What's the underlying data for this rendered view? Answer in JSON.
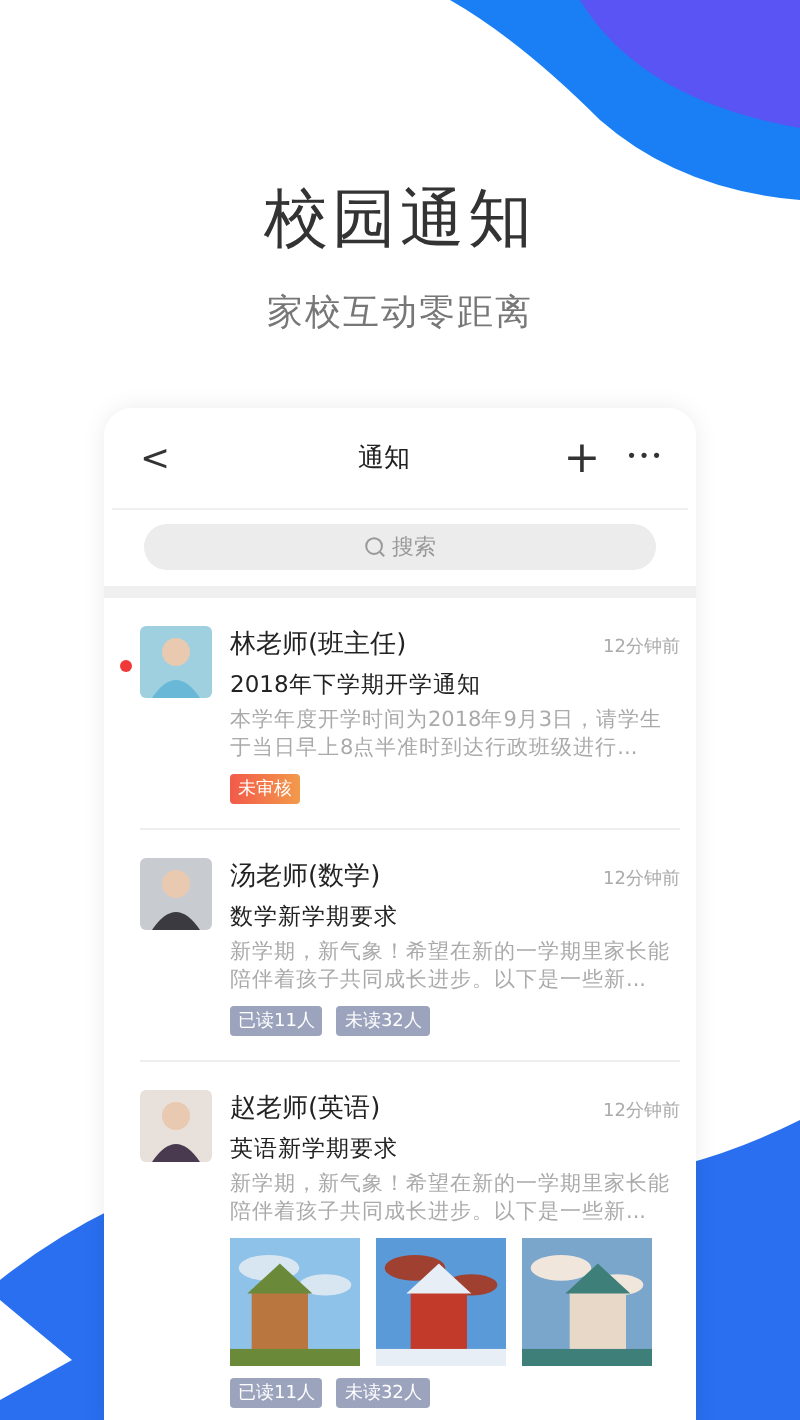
{
  "hero": {
    "title": "校园通知",
    "subtitle": "家校互动零距离"
  },
  "header": {
    "back": "<",
    "title": "通知",
    "add": "+",
    "more": "•••"
  },
  "search": {
    "placeholder": "搜索"
  },
  "notices": [
    {
      "sender": "林老师(班主任)",
      "time": "12分钟前",
      "subject": "2018年下学期开学通知",
      "preview": "本学年度开学时间为2018年9月3日，请学生于当日早上8点半准时到达行政班级进行...",
      "unread": true,
      "tags": [
        {
          "kind": "status",
          "text": "未审核"
        }
      ]
    },
    {
      "sender": "汤老师(数学)",
      "time": "12分钟前",
      "subject": "数学新学期要求",
      "preview": "新学期，新气象！希望在新的一学期里家长能陪伴着孩子共同成长进步。以下是一些新...",
      "unread": false,
      "tags": [
        {
          "kind": "count",
          "text": "已读11人"
        },
        {
          "kind": "count",
          "text": "未读32人"
        }
      ]
    },
    {
      "sender": "赵老师(英语)",
      "time": "12分钟前",
      "subject": "英语新学期要求",
      "preview": "新学期，新气象！希望在新的一学期里家长能陪伴着孩子共同成长进步。以下是一些新...",
      "unread": false,
      "tags": [
        {
          "kind": "count",
          "text": "已读11人"
        },
        {
          "kind": "count",
          "text": "未读32人"
        }
      ],
      "pictures": [
        {
          "kind": "picture"
        },
        {
          "kind": "picture"
        },
        {
          "kind": "picture"
        }
      ]
    }
  ]
}
